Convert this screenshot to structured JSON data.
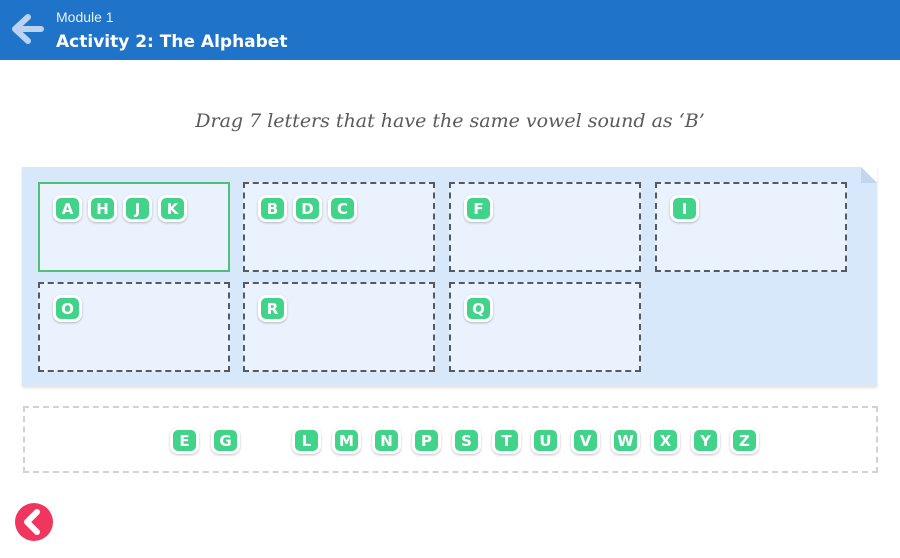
{
  "header": {
    "module": "Module 1",
    "title": "Activity 2: The Alphabet",
    "back_icon": "arrow-left-icon",
    "background": "#1f73c9"
  },
  "instruction": "Drag 7 letters that have the same vowel sound as ‘B’",
  "zones": [
    {
      "letters": [
        "A",
        "H",
        "J",
        "K"
      ],
      "active": true
    },
    {
      "letters": [
        "B",
        "D",
        "C"
      ],
      "active": false
    },
    {
      "letters": [
        "F"
      ],
      "active": false
    },
    {
      "letters": [
        "I"
      ],
      "active": false
    },
    {
      "letters": [
        "O"
      ],
      "active": false
    },
    {
      "letters": [
        "R"
      ],
      "active": false
    },
    {
      "letters": [
        "Q"
      ],
      "active": false
    }
  ],
  "tray": {
    "letters": [
      "E",
      "G",
      "L",
      "M",
      "N",
      "P",
      "S",
      "T",
      "U",
      "V",
      "W",
      "X",
      "Y",
      "Z"
    ]
  },
  "footer": {
    "prev_icon": "chevron-left-circle-icon"
  },
  "colors": {
    "tile": "#42d38a",
    "accent_red": "#f0355e",
    "board": "#d8e8fb",
    "active_zone_border": "#4fbf7a"
  }
}
